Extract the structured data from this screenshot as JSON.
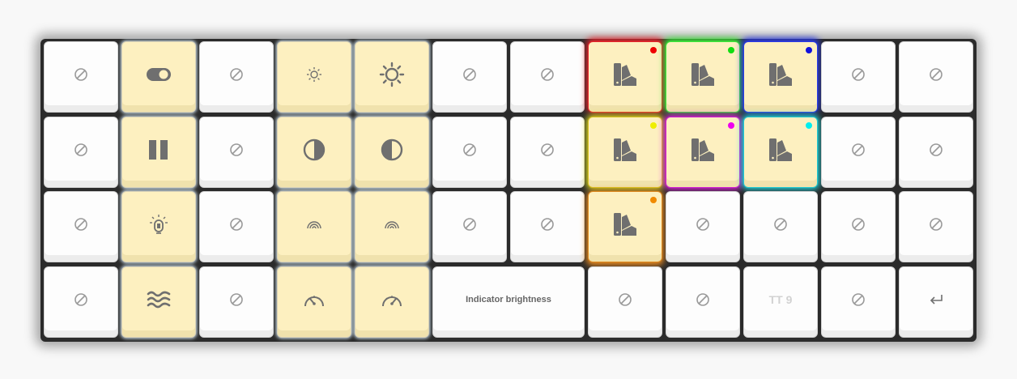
{
  "keyboard": {
    "title": "",
    "wide_key_label": "Indicator brightness",
    "tt_key_label": "TT 9",
    "glow_colors": {
      "key_r0_c7": "#e8252c",
      "key_r0_c8": "#3ee83a",
      "key_r0_c9": "#2a3be8",
      "key_r1_c7": "#e0e020",
      "key_r1_c8": "#e020e0",
      "key_r1_c9": "#20d8e0",
      "key_r2_c7": "#e88a20"
    },
    "active_key_color": "#fdf0c0",
    "inactive_key_color": "#fdfdfd",
    "icons": {
      "none": "no-action-icon",
      "toggle": "toggle-icon",
      "pause": "pause-icon",
      "brightness_low": "brightness-down-icon",
      "brightness_high": "brightness-up-icon",
      "contrast_left": "contrast-left-icon",
      "contrast_right": "contrast-right-icon",
      "palette": "color-swatch-icon",
      "bulb": "light-bulb-icon",
      "rainbow": "rainbow-icon",
      "waves": "wave-icon",
      "speed": "speedometer-icon",
      "enter": "return-icon"
    }
  }
}
